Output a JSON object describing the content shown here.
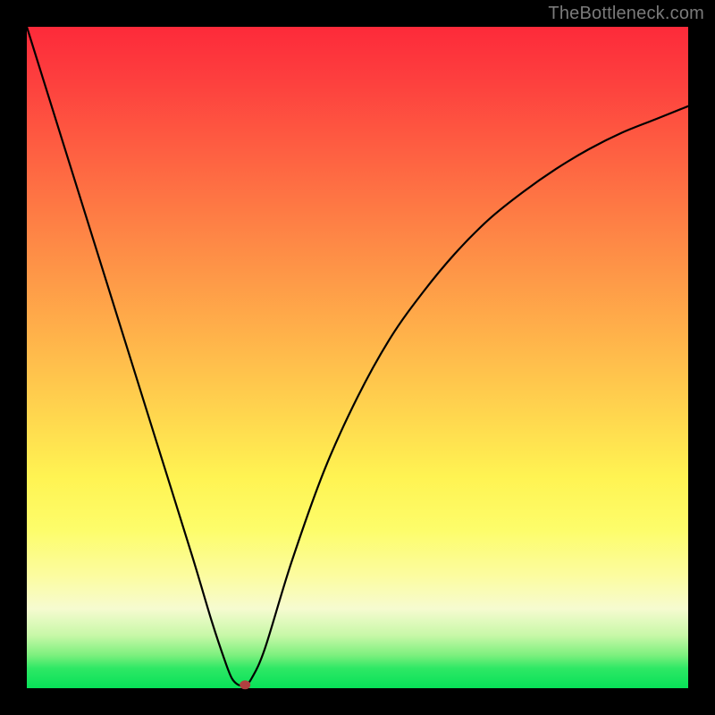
{
  "watermark": "TheBottleneck.com",
  "chart_data": {
    "type": "line",
    "title": "",
    "xlabel": "",
    "ylabel": "",
    "xlim": [
      0,
      100
    ],
    "ylim": [
      0,
      100
    ],
    "grid": false,
    "series": [
      {
        "name": "curve",
        "x": [
          0,
          5,
          10,
          15,
          20,
          25,
          28,
          30,
          31,
          32,
          33,
          34,
          36,
          40,
          45,
          50,
          55,
          60,
          65,
          70,
          75,
          80,
          85,
          90,
          95,
          100
        ],
        "values": [
          100,
          84,
          68,
          52,
          36,
          20,
          10,
          4,
          1.5,
          0.5,
          0.5,
          1.5,
          6,
          19,
          33,
          44,
          53,
          60,
          66,
          71,
          75,
          78.5,
          81.5,
          84,
          86,
          88
        ]
      }
    ],
    "marker": {
      "x": 33,
      "y": 0.5,
      "color": "#b04040"
    },
    "background_gradient": {
      "direction": "vertical",
      "stops": [
        {
          "pos": 0.0,
          "color": "#fd2a3a"
        },
        {
          "pos": 0.33,
          "color": "#fe8a46"
        },
        {
          "pos": 0.68,
          "color": "#fff352"
        },
        {
          "pos": 0.88,
          "color": "#f6fbd0"
        },
        {
          "pos": 1.0,
          "color": "#07e158"
        }
      ]
    }
  }
}
